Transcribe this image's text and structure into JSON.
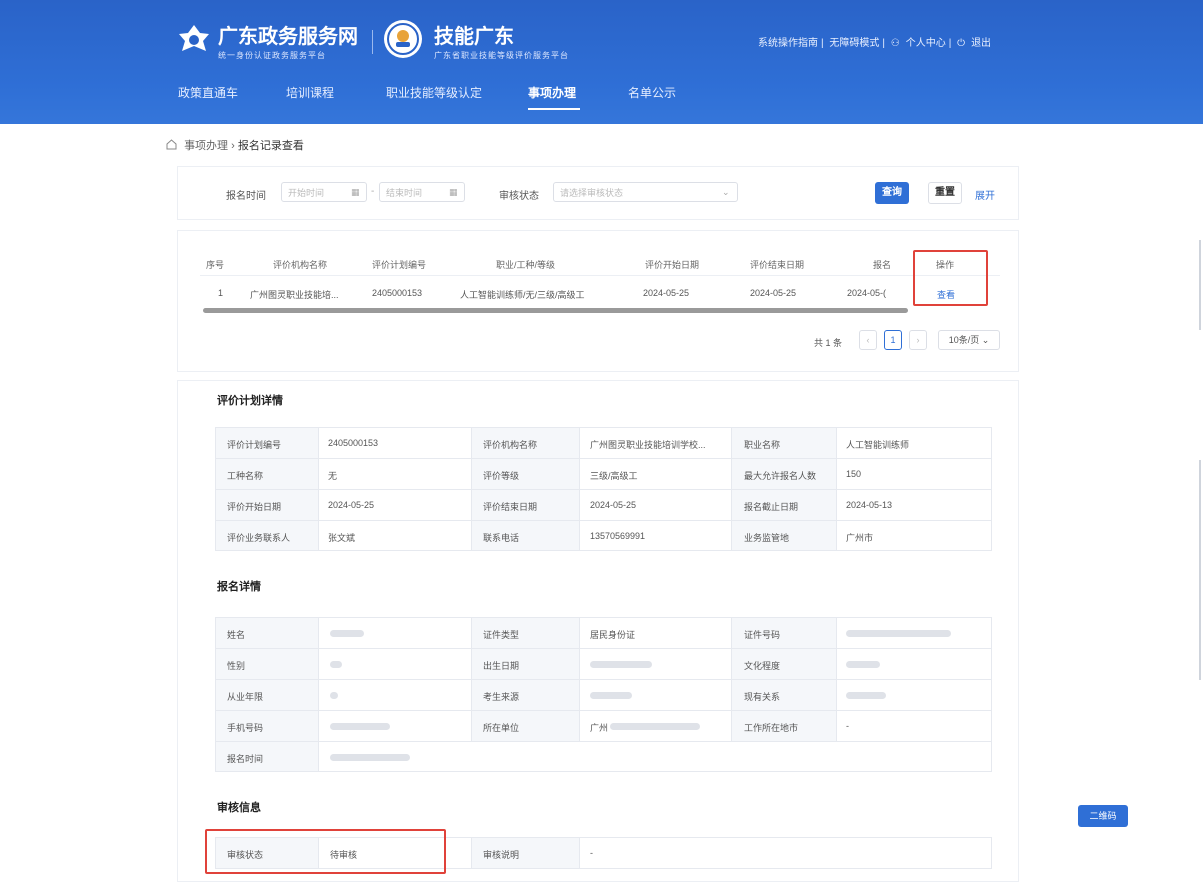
{
  "header": {
    "portal_name": "广东政务服务网",
    "portal_sub": "统一身份认证政务服务平台",
    "site_name": "技能广东",
    "site_sub": "广东省职业技能等级评价服务平台",
    "links": [
      "系统操作指南",
      "无障碍模式",
      "个人中心",
      "退出"
    ],
    "nav": [
      "政策直通车",
      "培训课程",
      "职业技能等级认定",
      "事项办理",
      "名单公示"
    ],
    "nav_active": "事项办理"
  },
  "breadcrumb": [
    "事项办理",
    "报名记录查看"
  ],
  "filter": {
    "time_label": "报名时间",
    "start_placeholder": "开始时间",
    "end_placeholder": "结束时间",
    "status_label": "审核状态",
    "status_placeholder": "请选择审核状态",
    "search": "查询",
    "reset": "重置",
    "expand": "展开"
  },
  "list": {
    "headers": [
      "序号",
      "评价机构名称",
      "评价计划编号",
      "职业/工种/等级",
      "评价开始日期",
      "评价结束日期",
      "报名",
      "操作"
    ],
    "rows": [
      [
        "1",
        "广州图灵职业技能培...",
        "2405000153",
        "人工智能训练师/无/三级/高级工",
        "2024-05-25",
        "2024-05-25",
        "2024-05-(",
        "查看"
      ]
    ],
    "total": "共 1 条",
    "page": "1",
    "page_size": "10条/页"
  },
  "plan_detail": {
    "title": "评价计划详情",
    "rows": [
      [
        "评价计划编号",
        "2405000153",
        "评价机构名称",
        "广州图灵职业技能培训学校...",
        "职业名称",
        "人工智能训练师"
      ],
      [
        "工种名称",
        "无",
        "评价等级",
        "三级/高级工",
        "最大允许报名人数",
        "150"
      ],
      [
        "评价开始日期",
        "2024-05-25",
        "评价结束日期",
        "2024-05-25",
        "报名截止日期",
        "2024-05-13"
      ],
      [
        "评价业务联系人",
        "张文斌",
        "联系电话",
        "13570569991",
        "业务监管地",
        "广州市"
      ]
    ]
  },
  "signup_detail": {
    "title": "报名详情",
    "labels": [
      [
        "姓名",
        "证件类型",
        "证件号码"
      ],
      [
        "性别",
        "出生日期",
        "文化程度"
      ],
      [
        "从业年限",
        "考生来源",
        "现有关系"
      ],
      [
        "手机号码",
        "所在单位",
        "工作所在地市"
      ],
      [
        "报名时间"
      ]
    ],
    "values": [
      [
        "",
        "居民身份证",
        ""
      ],
      [
        "",
        "",
        ""
      ],
      [
        "",
        "",
        ""
      ],
      [
        "",
        "广州",
        "-"
      ],
      [
        ""
      ]
    ]
  },
  "audit": {
    "title": "审核信息",
    "status_label": "审核状态",
    "status_value": "待审核",
    "desc_label": "审核说明",
    "desc_value": "-"
  },
  "side_button": "二维码"
}
